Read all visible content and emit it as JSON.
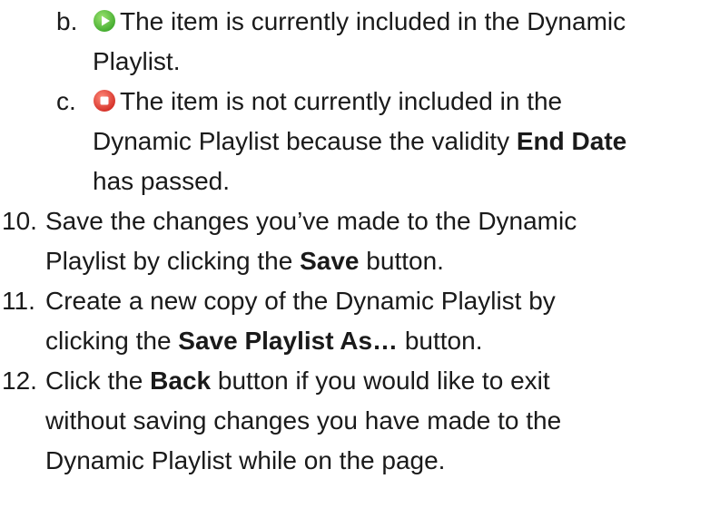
{
  "sub_items": [
    {
      "marker": "b.",
      "icon": "green-play-icon",
      "icon_color": "#5cc93a",
      "line1": "The item is currently included in the Dynamic",
      "line2": "Playlist."
    },
    {
      "marker": "c.",
      "icon": "red-stop-icon",
      "icon_color": "#e8433b",
      "line1": "The item is not currently included in the",
      "line2_pre": "Dynamic Playlist because the validity ",
      "line2_bold": "End Date",
      "line3": "has passed."
    }
  ],
  "steps": [
    {
      "marker": "10.",
      "line1": "Save the changes you’ve made to the Dynamic",
      "line2_pre": "Playlist by clicking the ",
      "line2_bold": "Save",
      "line2_post": " button."
    },
    {
      "marker": "11.",
      "line1": "Create a new copy of the Dynamic Playlist by",
      "line2_pre": "clicking the ",
      "line2_bold": "Save Playlist As…",
      "line2_post": " button."
    },
    {
      "marker": "12.",
      "line1_pre": "Click the ",
      "line1_bold": "Back",
      "line1_post": " button if you would like to exit",
      "line2": "without saving changes you have made to the",
      "line3": "Dynamic Playlist while on the page."
    }
  ]
}
